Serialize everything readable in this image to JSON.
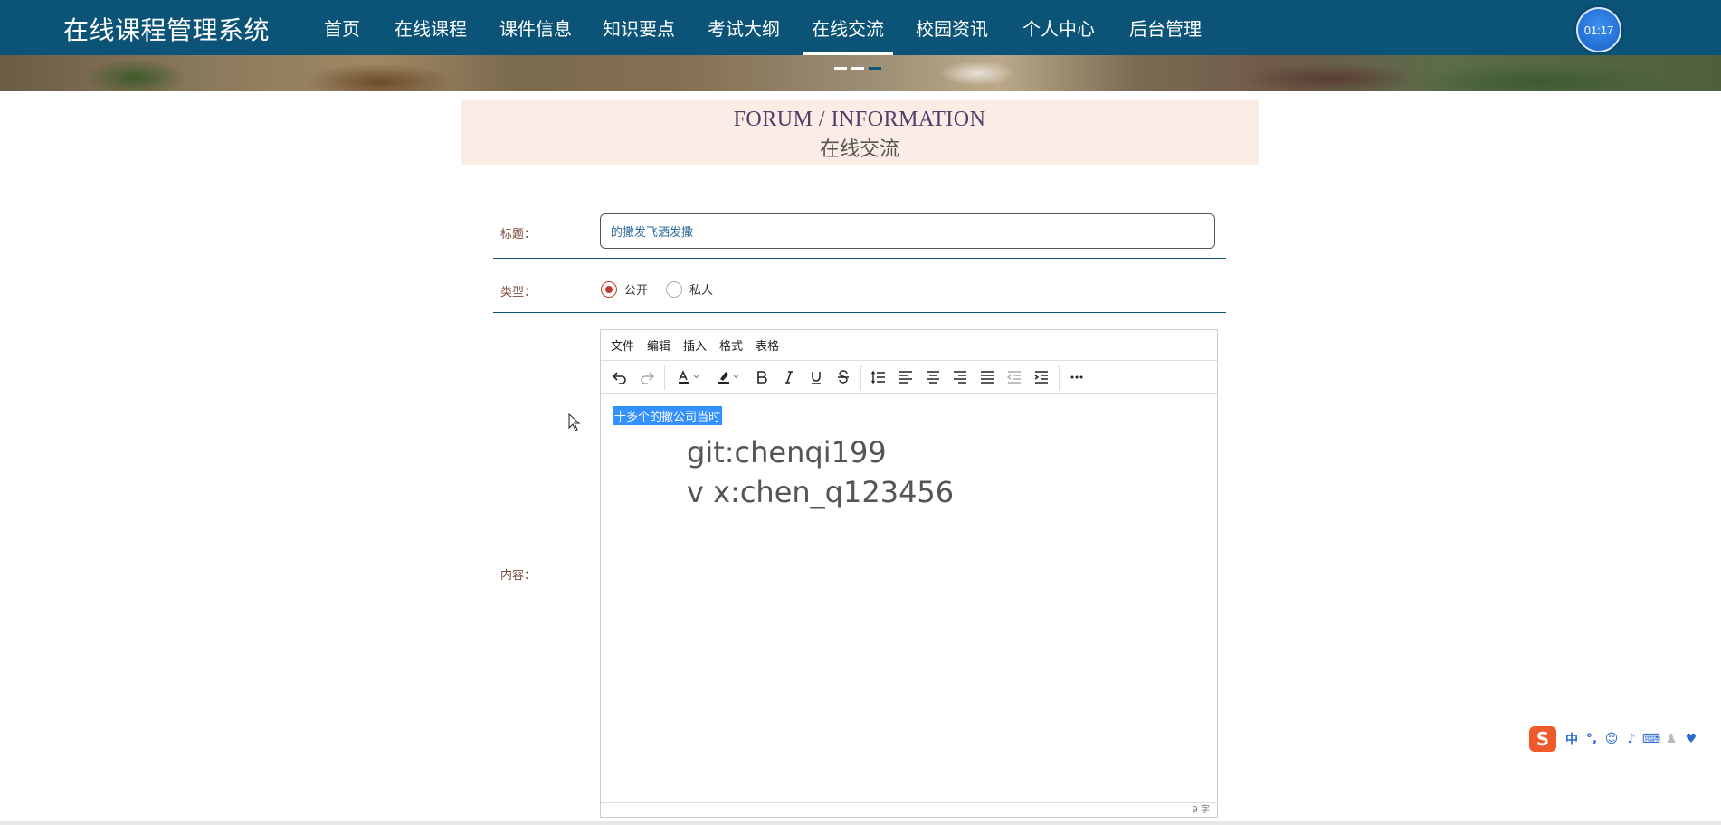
{
  "app": {
    "brand": "在线课程管理系统",
    "timer": "01:17"
  },
  "nav": {
    "items": [
      {
        "label": "首页"
      },
      {
        "label": "在线课程"
      },
      {
        "label": "课件信息"
      },
      {
        "label": "知识要点"
      },
      {
        "label": "考试大纲"
      },
      {
        "label": "在线交流",
        "active": true
      },
      {
        "label": "校园资讯"
      },
      {
        "label": "个人中心"
      },
      {
        "label": "后台管理"
      }
    ]
  },
  "section": {
    "title_en": "FORUM / INFORMATION",
    "title_cn": "在线交流"
  },
  "form": {
    "title_label": "标题：",
    "title_value": "的撒发飞洒发撒",
    "type_label": "类型：",
    "type_options": [
      {
        "label": "公开",
        "checked": true
      },
      {
        "label": "私人",
        "checked": false
      }
    ],
    "content_label": "内容："
  },
  "editor": {
    "menu": [
      "文件",
      "编辑",
      "插入",
      "格式",
      "表格"
    ],
    "toolbar_icons": [
      "undo-icon",
      "redo-icon",
      "text-color-icon",
      "highlight-color-icon",
      "bold-icon",
      "italic-icon",
      "underline-icon",
      "strikethrough-icon",
      "line-height-icon",
      "align-left-icon",
      "align-center-icon",
      "align-right-icon",
      "align-justify-icon",
      "outdent-icon",
      "indent-icon",
      "more-icon"
    ],
    "selected_text": "十多个的撒公司当时",
    "lines": [
      "git:chenqi199",
      "v x:chen_q123456"
    ],
    "word_count": "9 字"
  },
  "colors": {
    "nav_bg": "#0b5478",
    "header_bg": "#fbece6",
    "accent_red": "#c0392b",
    "ime_logo": "#ef5a2a"
  }
}
